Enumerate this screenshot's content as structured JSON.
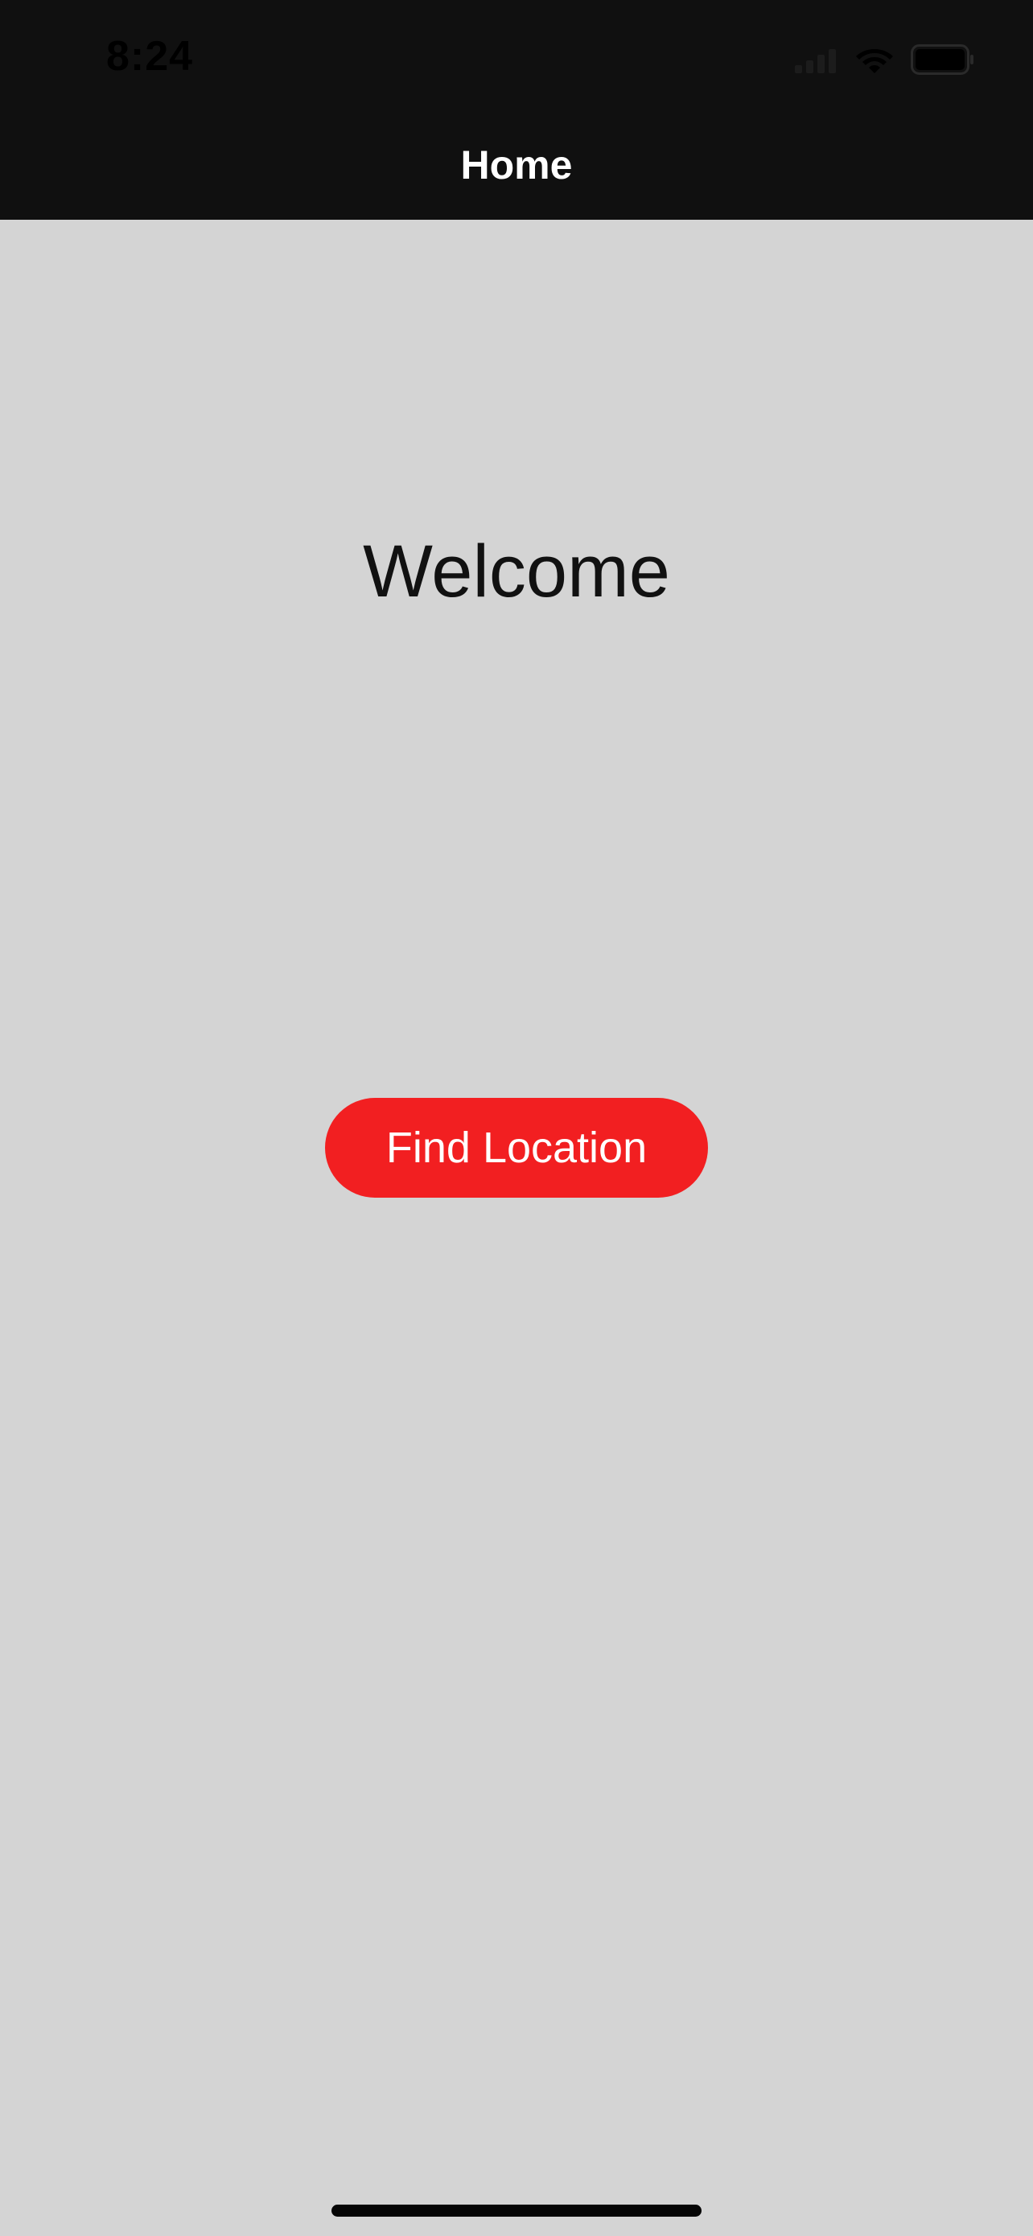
{
  "status_bar": {
    "time": "8:24",
    "icons": [
      "cellular-signal-icon",
      "wifi-icon",
      "battery-icon"
    ]
  },
  "nav_bar": {
    "title": "Home"
  },
  "main": {
    "heading": "Welcome",
    "primary_button_label": "Find Location"
  },
  "colors": {
    "top_bar_background": "#101010",
    "page_background": "#d4d4d4",
    "button_background": "#f21f21",
    "button_text": "#ffffff",
    "heading_text": "#111111"
  }
}
